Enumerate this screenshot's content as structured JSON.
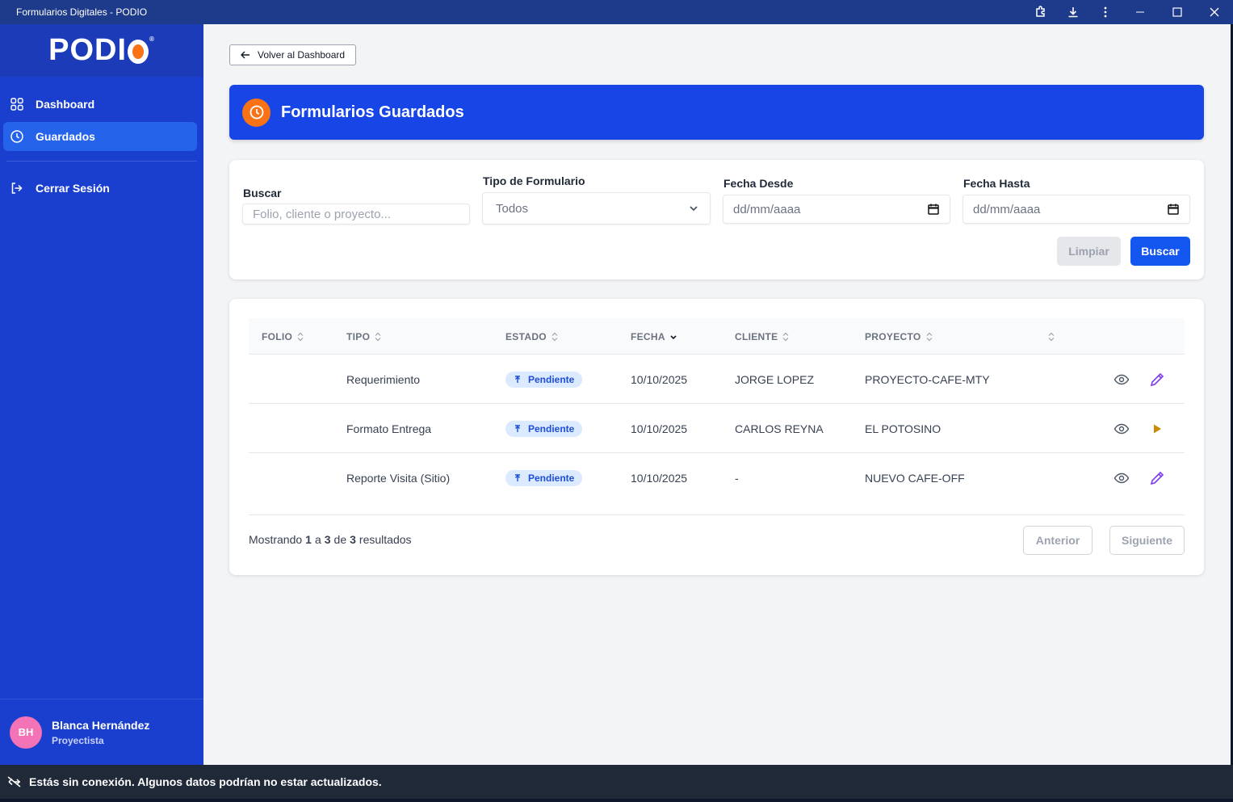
{
  "window": {
    "title": "Formularios Digitales - PODIO"
  },
  "sidebar": {
    "logo": "PODI",
    "items": [
      {
        "label": "Dashboard",
        "icon": "grid-icon"
      },
      {
        "label": "Guardados",
        "icon": "clock-icon"
      }
    ],
    "logout_label": "Cerrar Sesión",
    "user": {
      "initials": "BH",
      "name": "Blanca Hernández",
      "role": "Proyectista"
    }
  },
  "main": {
    "back_label": "Volver al Dashboard",
    "title": "Formularios Guardados",
    "filters": {
      "search_label": "Buscar",
      "search_placeholder": "Folio, cliente o proyecto...",
      "type_label": "Tipo de Formulario",
      "type_value": "Todos",
      "date_from_label": "Fecha Desde",
      "date_from_placeholder": "dd/mm/aaaa",
      "date_to_label": "Fecha Hasta",
      "date_to_placeholder": "dd/mm/aaaa",
      "clear_label": "Limpiar",
      "search_button_label": "Buscar"
    },
    "table": {
      "columns": [
        "FOLIO",
        "TIPO",
        "ESTADO",
        "FECHA",
        "CLIENTE",
        "PROYECTO"
      ],
      "rows": [
        {
          "folio": "",
          "tipo": "Requerimiento",
          "estado": "Pendiente",
          "fecha": "10/10/2025",
          "cliente": "JORGE LOPEZ",
          "proyecto": "PROYECTO-CAFE-MTY",
          "action": "edit"
        },
        {
          "folio": "",
          "tipo": "Formato Entrega",
          "estado": "Pendiente",
          "fecha": "10/10/2025",
          "cliente": "CARLOS REYNA",
          "proyecto": "EL POTOSINO",
          "action": "play"
        },
        {
          "folio": "",
          "tipo": "Reporte Visita (Sitio)",
          "estado": "Pendiente",
          "fecha": "10/10/2025",
          "cliente": "-",
          "proyecto": "NUEVO CAFE-OFF",
          "action": "edit"
        }
      ],
      "footer": {
        "prefix": "Mostrando",
        "from": "1",
        "sep1": "a",
        "to": "3",
        "sep2": "de",
        "total": "3",
        "suffix": "resultados"
      },
      "prev_label": "Anterior",
      "next_label": "Siguiente"
    }
  },
  "offline_banner": "Estás sin conexión. Algunos datos podrían no estar actualizados.",
  "colors": {
    "sidebar": "#1a3fcf",
    "accent": "#1846e6",
    "orange": "#f97316",
    "badge_bg": "#dbeafe",
    "badge_text": "#1d4ed8"
  }
}
